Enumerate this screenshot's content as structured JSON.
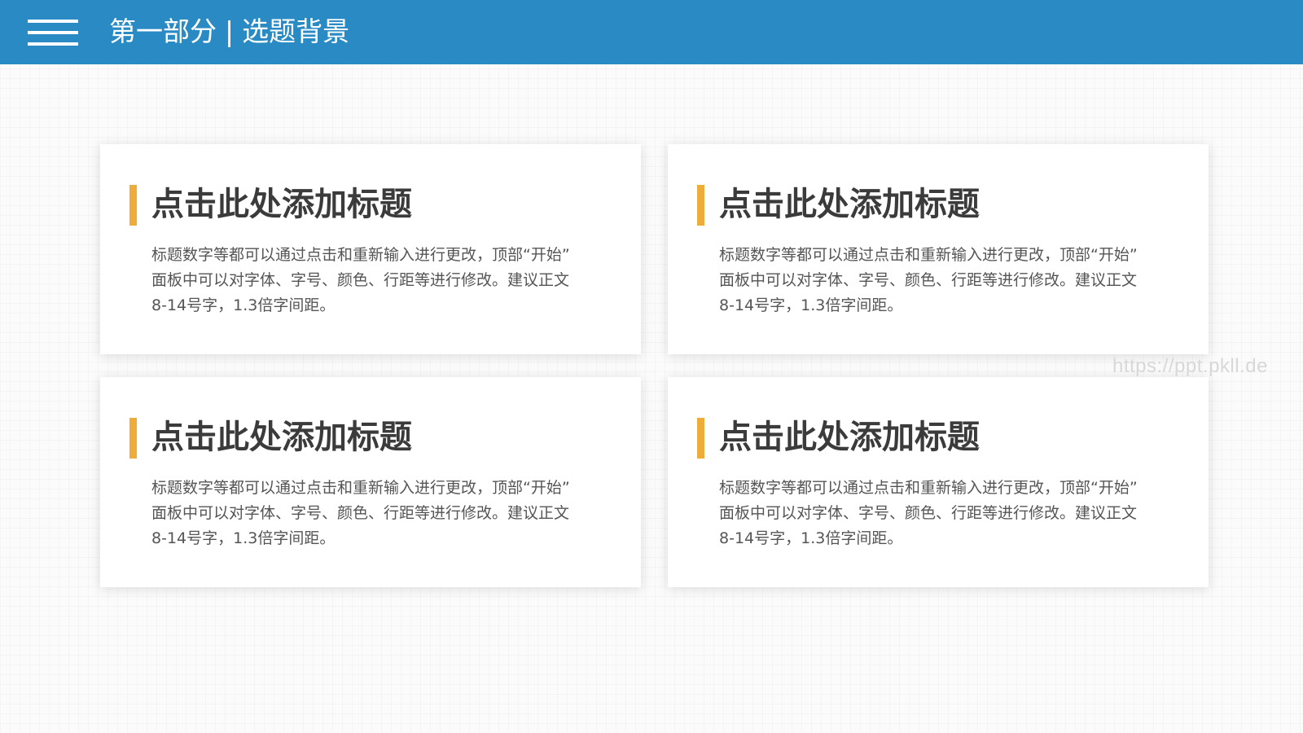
{
  "header": {
    "menu_icon": "hamburger-menu-icon",
    "section": "第一部分",
    "separator": "|",
    "topic": "选题背景",
    "background_color": "#2a8bc4"
  },
  "accent_color": "#f0ac38",
  "cards": [
    {
      "title": "点击此处添加标题",
      "body_lines": [
        "标题数字等都可以通过点击和重新输入进行更改，顶部“开始”",
        "面板中可以对字体、字号、颜色、行距等进行修改。建议正文",
        "8-14号字，1.3倍字间距。"
      ]
    },
    {
      "title": "点击此处添加标题",
      "body_lines": [
        "标题数字等都可以通过点击和重新输入进行更改，顶部“开始”",
        "面板中可以对字体、字号、颜色、行距等进行修改。建议正文",
        "8-14号字，1.3倍字间距。"
      ]
    },
    {
      "title": "点击此处添加标题",
      "body_lines": [
        "标题数字等都可以通过点击和重新输入进行更改，顶部“开始”",
        "面板中可以对字体、字号、颜色、行距等进行修改。建议正文",
        "8-14号字，1.3倍字间距。"
      ]
    },
    {
      "title": "点击此处添加标题",
      "body_lines": [
        "标题数字等都可以通过点击和重新输入进行更改，顶部“开始”",
        "面板中可以对字体、字号、颜色、行距等进行修改。建议正文",
        "8-14号字，1.3倍字间距。"
      ]
    }
  ],
  "watermark": "https://ppt.pkll.de"
}
